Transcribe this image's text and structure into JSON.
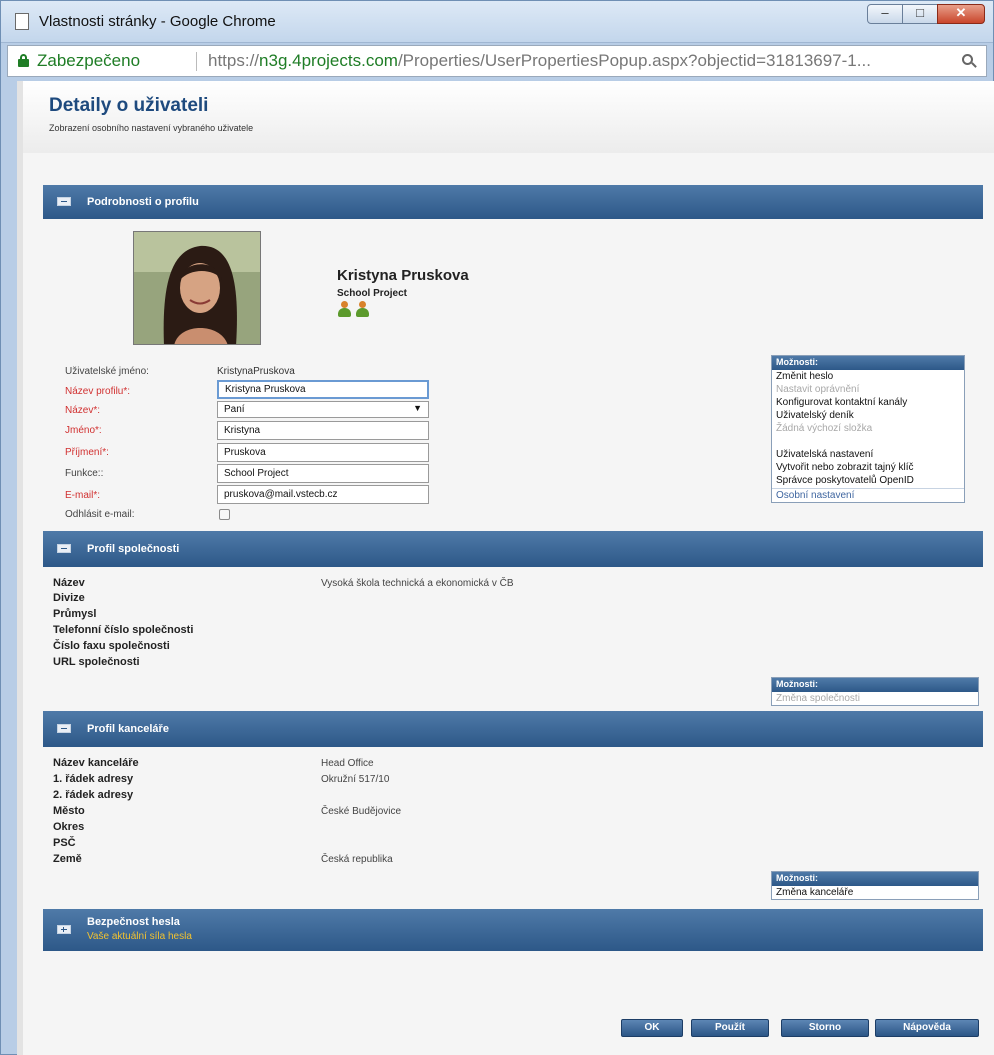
{
  "window": {
    "title": "Vlastnosti stránky - Google Chrome",
    "minimize": "–",
    "maximize": "□",
    "close": "✕"
  },
  "address": {
    "secure_label": "Zabezpečeno",
    "url_scheme": "https://",
    "url_host": "n3g.4projects.com",
    "url_path": "/Properties/UserPropertiesPopup.aspx?objectid=31813697-1..."
  },
  "page": {
    "title": "Detaily o uživateli",
    "subtitle": "Zobrazení osobního nastavení vybraného uživatele"
  },
  "profile_section": {
    "header": "Podrobnosti o profilu",
    "display_name": "Kristyna Pruskova",
    "company": "School Project",
    "fields": {
      "username_label": "Uživatelské jméno:",
      "username_value": "KristynaPruskova",
      "profile_name_label": "Název profilu*:",
      "profile_name_value": "Kristyna Pruskova",
      "salutation_label": "Název*:",
      "salutation_value": "Paní",
      "first_name_label": "Jméno*:",
      "first_name_value": "Kristyna",
      "last_name_label": "Příjmení*:",
      "last_name_value": "Pruskova",
      "function_label": "Funkce::",
      "function_value": "School Project",
      "email_label": "E-mail*:",
      "email_value": "pruskova@mail.vstecb.cz",
      "unsubscribe_label": "Odhlásit e-mail:"
    },
    "options": {
      "header": "Možnosti:",
      "items": [
        {
          "label": "Změnit heslo",
          "disabled": false
        },
        {
          "label": "Nastavit oprávnění",
          "disabled": true
        },
        {
          "label": "Konfigurovat kontaktní kanály",
          "disabled": false
        },
        {
          "label": "Uživatelský deník",
          "disabled": false
        },
        {
          "label": "Žádná výchozí složka",
          "disabled": true
        },
        {
          "label": "Uživatelská nastavení",
          "disabled": false
        },
        {
          "label": "Vytvořit nebo zobrazit tajný klíč",
          "disabled": false
        },
        {
          "label": "Správce poskytovatelů OpenID",
          "disabled": false
        }
      ],
      "footer": "Osobní nastavení"
    }
  },
  "company_section": {
    "header": "Profil společnosti",
    "labels": [
      "Název",
      "Divize",
      "Průmysl",
      "Telefonní číslo společnosti",
      "Číslo faxu společnosti",
      "URL společnosti"
    ],
    "name_value": "Vysoká škola technická a ekonomická v ČB",
    "options_header": "Možnosti:",
    "options_item": "Změna společnosti"
  },
  "office_section": {
    "header": "Profil kanceláře",
    "labels": [
      "Název kanceláře",
      "1. řádek adresy",
      "2. řádek adresy",
      "Město",
      "Okres",
      "PSČ",
      "Země"
    ],
    "values": [
      "Head Office",
      "Okružní 517/10",
      "",
      "České Budějovice",
      "",
      "",
      "Česká republika"
    ],
    "options_header": "Možnosti:",
    "options_item": "Změna kanceláře"
  },
  "password_section": {
    "header": "Bezpečnost hesla",
    "sub": "Vaše aktuální síla hesla"
  },
  "buttons": {
    "ok": "OK",
    "apply": "Použít",
    "cancel": "Storno",
    "help": "Nápověda"
  }
}
